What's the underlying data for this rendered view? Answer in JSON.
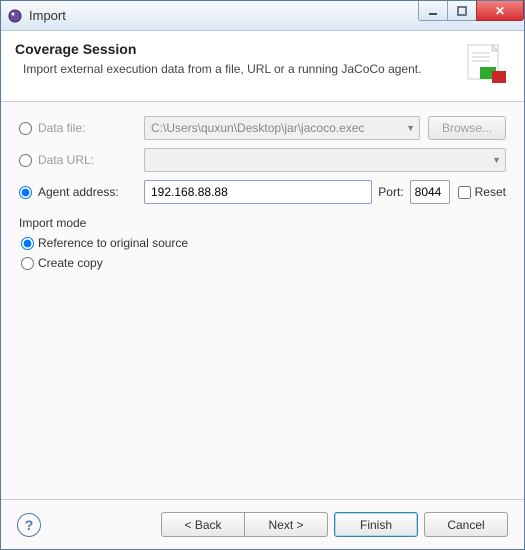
{
  "window": {
    "title": "Import"
  },
  "banner": {
    "title": "Coverage Session",
    "desc": "Import external execution data from a file, URL or a running JaCoCo agent."
  },
  "source": {
    "dataFile": {
      "label": "Data file:",
      "value": "C:\\Users\\quxun\\Desktop\\jar\\jacoco.exec",
      "browse": "Browse..."
    },
    "dataURL": {
      "label": "Data URL:",
      "value": ""
    },
    "agent": {
      "label": "Agent address:",
      "value": "192.168.88.88",
      "portLabel": "Port:",
      "port": "8044",
      "resetLabel": "Reset"
    }
  },
  "importMode": {
    "group": "Import mode",
    "ref": "Reference to original source",
    "copy": "Create copy"
  },
  "footer": {
    "back": "< Back",
    "next": "Next >",
    "finish": "Finish",
    "cancel": "Cancel"
  }
}
